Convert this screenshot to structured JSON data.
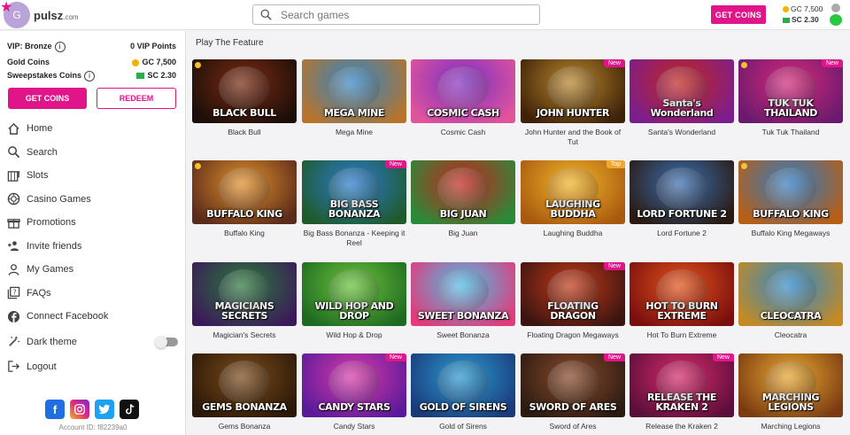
{
  "header": {
    "logo_letter": "G",
    "logo_text": "pulsz",
    "logo_suffix": ".com",
    "search_placeholder": "Search games",
    "get_coins": "GET COINS",
    "gc_balance": "GC 7,500",
    "sc_balance": "SC 2.30"
  },
  "sidebar": {
    "vip_label": "VIP: Bronze",
    "vip_points": "0 VIP Points",
    "gold_label": "Gold Coins",
    "gold_value": "GC 7,500",
    "sweep_label": "Sweepstakes Coins",
    "sweep_value": "SC 2.30",
    "get_coins": "GET COINS",
    "redeem": "REDEEM",
    "nav": [
      {
        "label": "Home",
        "icon": "home-icon"
      },
      {
        "label": "Search",
        "icon": "search-icon"
      },
      {
        "label": "Slots",
        "icon": "slots-icon"
      },
      {
        "label": "Casino Games",
        "icon": "casino-icon"
      },
      {
        "label": "Promotions",
        "icon": "gift-icon"
      },
      {
        "label": "Invite friends",
        "icon": "invite-icon"
      },
      {
        "label": "My Games",
        "icon": "user-icon"
      },
      {
        "label": "FAQs",
        "icon": "faq-icon"
      },
      {
        "label": "Connect Facebook",
        "icon": "facebook-icon"
      },
      {
        "label": "Dark theme",
        "icon": "theme-icon"
      },
      {
        "label": "Logout",
        "icon": "logout-icon"
      }
    ],
    "account_id": "Account ID: f82239a0"
  },
  "main": {
    "section_title": "Play The Feature",
    "games": [
      {
        "name": "Black Bull",
        "art": "BLACK BULL",
        "badge": "",
        "c1": "#7a2a12",
        "c2": "#1b0e08"
      },
      {
        "name": "Mega Mine",
        "art": "MEGA MINE",
        "badge": "",
        "c1": "#2f86c9",
        "c2": "#b8742a"
      },
      {
        "name": "Cosmic Cash",
        "art": "COSMIC CASH",
        "badge": "",
        "c1": "#7b2fc4",
        "c2": "#e0549b"
      },
      {
        "name": "John Hunter and the Book of Tut",
        "art": "JOHN HUNTER",
        "badge": "New",
        "c1": "#b9862d",
        "c2": "#3d2108"
      },
      {
        "name": "Santa's Wonderland",
        "art": "Santa's Wonderland",
        "badge": "",
        "c1": "#c2261f",
        "c2": "#7a1e8f"
      },
      {
        "name": "Tuk Tuk Thailand",
        "art": "TUK TUK THAILAND",
        "badge": "New",
        "c1": "#d5297a",
        "c2": "#6a1a6e"
      },
      {
        "name": "Buffalo King",
        "art": "BUFFALO KING",
        "badge": "",
        "c1": "#e0902a",
        "c2": "#5a2a1a"
      },
      {
        "name": "Big Bass Bonanza - Keeping it Reel",
        "art": "BIG BASS BONANZA",
        "badge": "New",
        "c1": "#2a7bd1",
        "c2": "#1f5a2a"
      },
      {
        "name": "Big Juan",
        "art": "BIG JUAN",
        "badge": "",
        "c1": "#c8241c",
        "c2": "#2a8a3a"
      },
      {
        "name": "Laughing Buddha",
        "art": "LAUGHING BUDDHA",
        "badge": "Top",
        "c1": "#f1b52a",
        "c2": "#a8590f"
      },
      {
        "name": "Lord Fortune 2",
        "art": "LORD FORTUNE 2",
        "badge": "",
        "c1": "#3a6fb0",
        "c2": "#2a1a12"
      },
      {
        "name": "Buffalo King Megaways",
        "art": "BUFFALO KING",
        "badge": "",
        "c1": "#2c7cc8",
        "c2": "#b85f16"
      },
      {
        "name": "Magician's Secrets",
        "art": "MAGICIANS SECRETS",
        "badge": "",
        "c1": "#2a7a3a",
        "c2": "#3b1a5a"
      },
      {
        "name": "Wild Hop & Drop",
        "art": "WILD HOP AND DROP",
        "badge": "",
        "c1": "#6cc23a",
        "c2": "#1e6a22"
      },
      {
        "name": "Sweet Bonanza",
        "art": "SWEET BONANZA",
        "badge": "",
        "c1": "#4ac0e8",
        "c2": "#e23a7a"
      },
      {
        "name": "Floating Dragon Megaways",
        "art": "FLOATING DRAGON",
        "badge": "New",
        "c1": "#c23a1a",
        "c2": "#3a1410"
      },
      {
        "name": "Hot To Burn Extreme",
        "art": "HOT TO BURN EXTREME",
        "badge": "",
        "c1": "#e2541a",
        "c2": "#7a0e0e"
      },
      {
        "name": "Cleocatra",
        "art": "CLEOCATRA",
        "badge": "",
        "c1": "#2a8ad0",
        "c2": "#c48a24"
      },
      {
        "name": "Gems Bonanza",
        "art": "GEMS BONANZA",
        "badge": "",
        "c1": "#7a4a1a",
        "c2": "#2a1808"
      },
      {
        "name": "Candy Stars",
        "art": "CANDY STARS",
        "badge": "New",
        "c1": "#d83aa8",
        "c2": "#5a1a9a"
      },
      {
        "name": "Gold of Sirens",
        "art": "GOLD OF SIRENS",
        "badge": "",
        "c1": "#2a9ad0",
        "c2": "#1a3a7a"
      },
      {
        "name": "Sword of Ares",
        "art": "SWORD OF ARES",
        "badge": "New",
        "c1": "#8a4a2a",
        "c2": "#2a1a12"
      },
      {
        "name": "Release the Kraken 2",
        "art": "RELEASE THE KRAKEN 2",
        "badge": "New",
        "c1": "#d82a6a",
        "c2": "#5a0e3a"
      },
      {
        "name": "Marching Legions",
        "art": "MARCHING LEGIONS",
        "badge": "",
        "c1": "#e8a830",
        "c2": "#7a3a12"
      }
    ]
  },
  "colors": {
    "accent": "#e0158a",
    "gc": "#f0b400",
    "sc": "#2dab4a"
  }
}
